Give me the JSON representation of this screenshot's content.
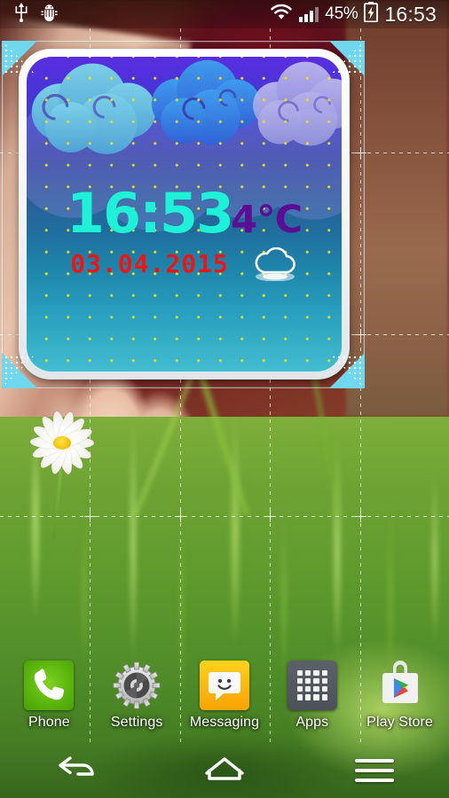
{
  "status_bar": {
    "left_icons": [
      {
        "name": "usb-icon",
        "glyph": "Ψ"
      },
      {
        "name": "android-debug-icon",
        "glyph": "bug"
      }
    ],
    "wifi_icon": "wifi-icon",
    "signal_icon": "signal-bars-icon",
    "battery_percent": "45%",
    "battery_icon": "battery-charging-icon",
    "clock": "16:53"
  },
  "widget": {
    "name": "weather-clock-widget",
    "time": "16:53",
    "temperature": "4°C",
    "date": "03.04.2015",
    "weather_condition_icon": "cloud-icon",
    "colors": {
      "time": "#1ff0d8",
      "temperature": "#5c0d96",
      "date": "#ef1414",
      "dot_grid": "#f2dc18",
      "resize_handle": "#6fd7ee"
    },
    "state": "resize-mode"
  },
  "dock": {
    "items": [
      {
        "label": "Phone",
        "icon": "phone-icon",
        "name": "dock-item-phone"
      },
      {
        "label": "Settings",
        "icon": "gear-icon",
        "name": "dock-item-settings"
      },
      {
        "label": "Messaging",
        "icon": "message-icon",
        "name": "dock-item-messaging"
      },
      {
        "label": "Apps",
        "icon": "apps-grid-icon",
        "name": "dock-item-apps"
      },
      {
        "label": "Play Store",
        "icon": "play-store-icon",
        "name": "dock-item-play-store"
      }
    ]
  },
  "nav_bar": {
    "back": "back-icon",
    "home": "home-icon",
    "menu": "menu-icon"
  }
}
